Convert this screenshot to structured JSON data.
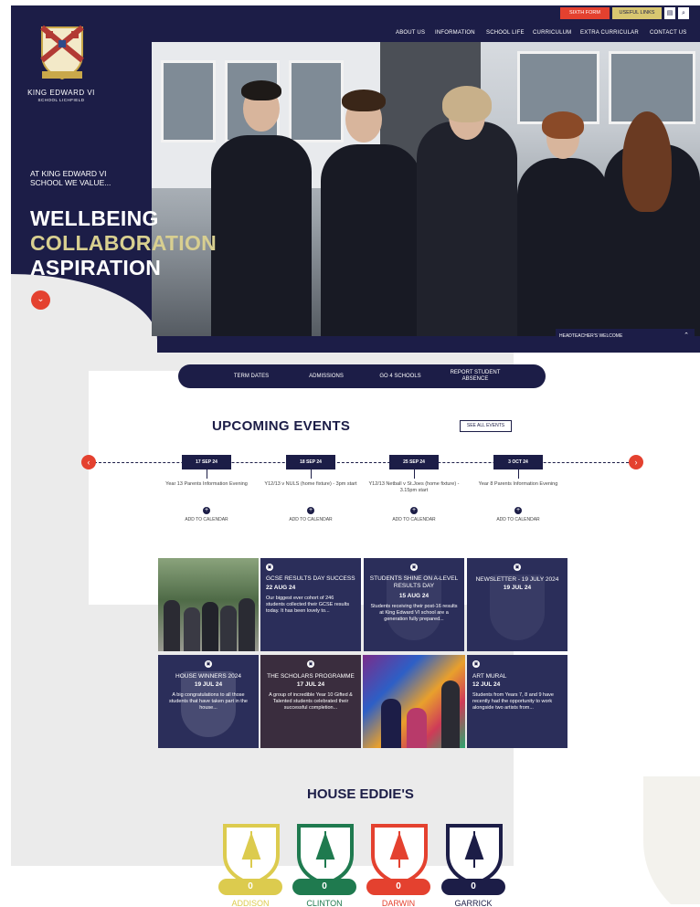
{
  "school": {
    "name": "KING EDWARD VI",
    "subtitle": "SCHOOL LICHFIELD"
  },
  "topbar": {
    "sixth_form": "SIXTH FORM",
    "useful_links": "USEFUL LINKS",
    "translate_icon": "translate-icon",
    "search_icon": "search-icon"
  },
  "nav": [
    "ABOUT US",
    "INFORMATION",
    "SCHOOL LIFE",
    "CURRICULUM",
    "EXTRA CURRICULAR",
    "CONTACT US"
  ],
  "hero": {
    "intro": "AT KING EDWARD VI SCHOOL WE VALUE...",
    "values": [
      "WELLBEING",
      "COLLABORATION",
      "ASPIRATION"
    ],
    "headteacher_welcome": "HEADTEACHER'S WELCOME"
  },
  "quicklinks": [
    "TERM DATES",
    "ADMISSIONS",
    "GO 4 SCHOOLS",
    "REPORT STUDENT ABSENCE"
  ],
  "events": {
    "title": "UPCOMING EVENTS",
    "see_all": "SEE ALL EVENTS",
    "add_label": "ADD TO CALENDAR",
    "items": [
      {
        "date": "17 SEP 24",
        "name": "Year 13 Parents Information Evening"
      },
      {
        "date": "18 SEP 24",
        "name": "Y12/13 v NULS (home fixture) - 3pm start"
      },
      {
        "date": "25 SEP 24",
        "name": "Y12/13 Netball v St.Joes (home fixture) - 3.15pm start"
      },
      {
        "date": "3 OCT 24",
        "name": "Year 8 Parents Information Evening"
      }
    ]
  },
  "news": [
    {
      "title": "GCSE RESULTS DAY SUCCESS",
      "date": "22 AUG 24",
      "text": "Our biggest ever cohort of 246 students collected their GCSE results today. It has been lovely to..."
    },
    {
      "title": "STUDENTS SHINE ON A-LEVEL RESULTS DAY",
      "date": "15 AUG 24",
      "text": "Students receiving their post-16 results at King Edward VI school are a generation fully prepared..."
    },
    {
      "title": "NEWSLETTER - 19 JULY 2024",
      "date": "19 JUL 24",
      "text": ""
    },
    {
      "title": "HOUSE WINNERS 2024",
      "date": "19 JUL 24",
      "text": "A big congratulations to all those students that have taken part in the house..."
    },
    {
      "title": "THE SCHOLARS PROGRAMME",
      "date": "17 JUL 24",
      "text": "A group of incredible Year 10 Gifted & Talented students celebrated their successful completion..."
    },
    {
      "title": "ART MURAL",
      "date": "12 JUL 24",
      "text": "Students from Years 7, 8 and 9 have recently had the opportunity to work alongside two artists from..."
    }
  ],
  "houses": {
    "title": "HOUSE EDDIE'S",
    "items": [
      {
        "name": "ADDISON",
        "score": "0",
        "color": "#dccb4e"
      },
      {
        "name": "CLINTON",
        "score": "0",
        "color": "#1f7a4f"
      },
      {
        "name": "DARWIN",
        "score": "0",
        "color": "#e4412f"
      },
      {
        "name": "GARRICK",
        "score": "0",
        "color": "#1c1d47"
      }
    ]
  },
  "colors": {
    "navy": "#1c1d47",
    "red": "#e4412f",
    "gold": "#d8cf90"
  }
}
